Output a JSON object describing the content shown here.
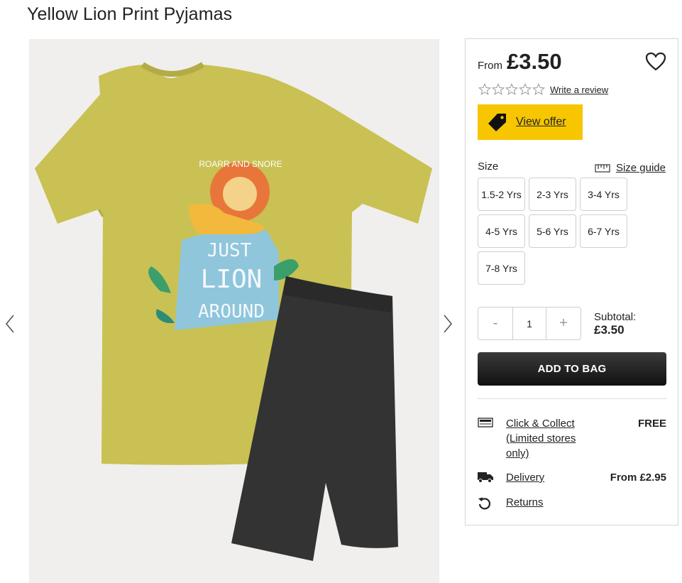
{
  "product": {
    "title": "Yellow Lion Print Pyjamas",
    "shirt_print": {
      "line1": "ROARR AND SNORE",
      "line2": "JUST",
      "line3": "LION",
      "line4": "AROUND"
    }
  },
  "colors": {
    "offer_yellow": "#f7c600",
    "add_button": "#1a1a1a",
    "shirt": "#c9c153",
    "shorts": "#333333"
  },
  "pricing": {
    "from_label": "From",
    "price": "£3.50"
  },
  "reviews": {
    "rating": 0,
    "max": 5,
    "link_label": "Write a review"
  },
  "offer": {
    "label": "View offer",
    "icon": "tag-icon"
  },
  "size": {
    "label": "Size",
    "guide_label": "Size guide",
    "options": [
      "1.5-2 Yrs",
      "2-3 Yrs",
      "3-4 Yrs",
      "4-5 Yrs",
      "5-6 Yrs",
      "6-7 Yrs",
      "7-8 Yrs"
    ]
  },
  "quantity": {
    "minus": "-",
    "value": "1",
    "plus": "+"
  },
  "subtotal": {
    "label": "Subtotal:",
    "amount": "£3.50"
  },
  "add_to_bag": "ADD TO BAG",
  "fulfilment": {
    "click_collect": {
      "label": "Click & Collect (Limited stores only)",
      "value": "FREE",
      "icon": "store-icon"
    },
    "delivery": {
      "label": "Delivery",
      "value": "From £2.95",
      "icon": "truck-icon"
    },
    "returns": {
      "label": "Returns",
      "icon": "returns-icon"
    }
  }
}
